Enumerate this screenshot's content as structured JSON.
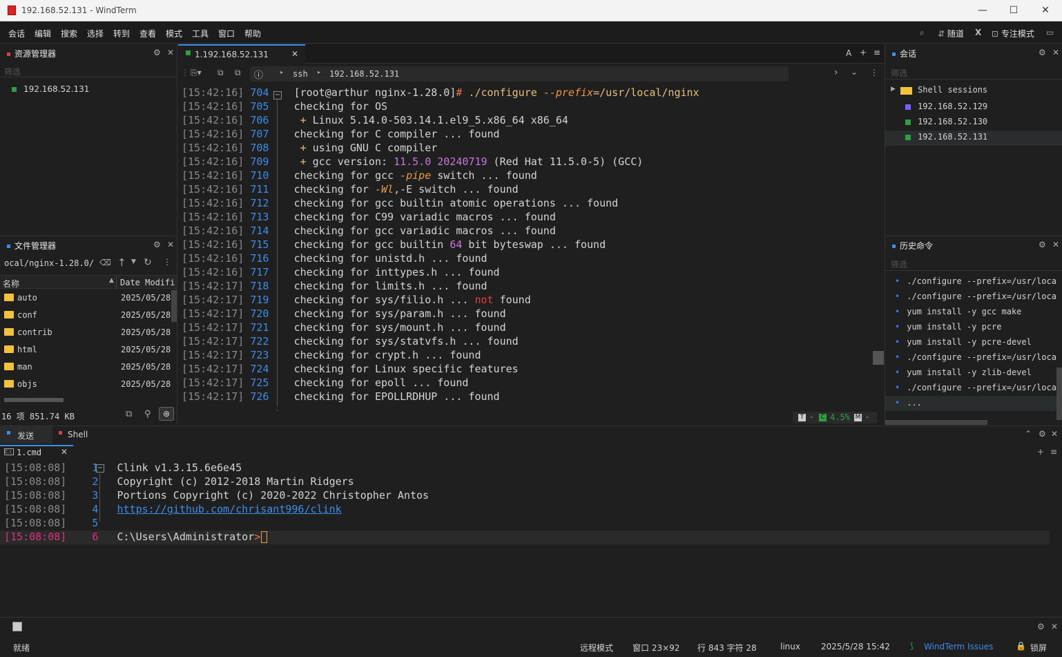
{
  "window": {
    "title": "192.168.52.131 - WindTerm"
  },
  "menu": [
    "会话",
    "编辑",
    "搜索",
    "选择",
    "转到",
    "查看",
    "模式",
    "工具",
    "窗口",
    "帮助"
  ],
  "right_tools": {
    "random": "随道",
    "focus": "专注模式"
  },
  "explorer": {
    "title": "资源管理器",
    "filter": "筛选",
    "item": "192.168.52.131"
  },
  "files": {
    "title": "文件管理器",
    "path": "ocal/nginx-1.28.0/",
    "col_name": "名称",
    "col_date": "Date Modifi",
    "rows": [
      {
        "name": "auto",
        "date": "2025/05/28"
      },
      {
        "name": "conf",
        "date": "2025/05/28"
      },
      {
        "name": "contrib",
        "date": "2025/05/28"
      },
      {
        "name": "html",
        "date": "2025/05/28"
      },
      {
        "name": "man",
        "date": "2025/05/28"
      },
      {
        "name": "objs",
        "date": "2025/05/28"
      }
    ],
    "summary": "16 项 851.74 KB"
  },
  "tab": {
    "label": "1.192.168.52.131",
    "font_btn": "A"
  },
  "crumb": {
    "proto": "ssh",
    "host": "192.168.52.131"
  },
  "terminal": {
    "lines": [
      {
        "ts": "[15:42:16]",
        "n": "704",
        "segs": [
          {
            "t": "[root@arthur nginx-1.28.0]",
            "c": "#d4d4d4"
          },
          {
            "t": "# ",
            "c": "#e8764b"
          },
          {
            "t": "./configure ",
            "c": "#e5c07b"
          },
          {
            "t": "--prefix",
            "c": "#e89a3c",
            "i": true
          },
          {
            "t": "=/usr/local/nginx",
            "c": "#e5c07b"
          }
        ]
      },
      {
        "ts": "[15:42:16]",
        "n": "705",
        "segs": [
          {
            "t": "checking for OS",
            "c": "#d4d4d4"
          }
        ]
      },
      {
        "ts": "[15:42:16]",
        "n": "706",
        "segs": [
          {
            "t": " + ",
            "c": "#e5c07b"
          },
          {
            "t": "Linux 5.14.0-503.14.1.el9_5.x86_64 x86_64",
            "c": "#d4d4d4"
          }
        ]
      },
      {
        "ts": "[15:42:16]",
        "n": "707",
        "segs": [
          {
            "t": "checking for C compiler ... found",
            "c": "#d4d4d4"
          }
        ]
      },
      {
        "ts": "[15:42:16]",
        "n": "708",
        "segs": [
          {
            "t": " + ",
            "c": "#e5c07b"
          },
          {
            "t": "using GNU C compiler",
            "c": "#d4d4d4"
          }
        ]
      },
      {
        "ts": "[15:42:16]",
        "n": "709",
        "segs": [
          {
            "t": " + ",
            "c": "#e5c07b"
          },
          {
            "t": "gcc version: ",
            "c": "#d4d4d4"
          },
          {
            "t": "11.5.0 20240719",
            "c": "#c678dd"
          },
          {
            "t": " (Red Hat 11.5.0-5) (GCC)",
            "c": "#d4d4d4"
          }
        ]
      },
      {
        "ts": "[15:42:16]",
        "n": "710",
        "segs": [
          {
            "t": "checking for gcc ",
            "c": "#d4d4d4"
          },
          {
            "t": "-pipe",
            "c": "#e89a3c",
            "i": true
          },
          {
            "t": " switch ... found",
            "c": "#d4d4d4"
          }
        ]
      },
      {
        "ts": "[15:42:16]",
        "n": "711",
        "segs": [
          {
            "t": "checking for ",
            "c": "#d4d4d4"
          },
          {
            "t": "-Wl",
            "c": "#e89a3c",
            "i": true
          },
          {
            "t": ",-E switch ... found",
            "c": "#d4d4d4"
          }
        ]
      },
      {
        "ts": "[15:42:16]",
        "n": "712",
        "segs": [
          {
            "t": "checking for gcc builtin atomic operations ... found",
            "c": "#d4d4d4"
          }
        ]
      },
      {
        "ts": "[15:42:16]",
        "n": "713",
        "segs": [
          {
            "t": "checking for C99 variadic macros ... found",
            "c": "#d4d4d4"
          }
        ]
      },
      {
        "ts": "[15:42:16]",
        "n": "714",
        "segs": [
          {
            "t": "checking for gcc variadic macros ... found",
            "c": "#d4d4d4"
          }
        ]
      },
      {
        "ts": "[15:42:16]",
        "n": "715",
        "segs": [
          {
            "t": "checking for gcc builtin ",
            "c": "#d4d4d4"
          },
          {
            "t": "64",
            "c": "#c678dd"
          },
          {
            "t": " bit byteswap ... found",
            "c": "#d4d4d4"
          }
        ]
      },
      {
        "ts": "[15:42:16]",
        "n": "716",
        "segs": [
          {
            "t": "checking for unistd.h ... found",
            "c": "#d4d4d4"
          }
        ]
      },
      {
        "ts": "[15:42:16]",
        "n": "717",
        "segs": [
          {
            "t": "checking for inttypes.h ... found",
            "c": "#d4d4d4"
          }
        ]
      },
      {
        "ts": "[15:42:17]",
        "n": "718",
        "segs": [
          {
            "t": "checking for limits.h ... found",
            "c": "#d4d4d4"
          }
        ]
      },
      {
        "ts": "[15:42:17]",
        "n": "719",
        "segs": [
          {
            "t": "checking for sys/filio.h ... ",
            "c": "#d4d4d4"
          },
          {
            "t": "not",
            "c": "#e04040"
          },
          {
            "t": " found",
            "c": "#d4d4d4"
          }
        ]
      },
      {
        "ts": "[15:42:17]",
        "n": "720",
        "segs": [
          {
            "t": "checking for sys/param.h ... found",
            "c": "#d4d4d4"
          }
        ]
      },
      {
        "ts": "[15:42:17]",
        "n": "721",
        "segs": [
          {
            "t": "checking for sys/mount.h ... found",
            "c": "#d4d4d4"
          }
        ]
      },
      {
        "ts": "[15:42:17]",
        "n": "722",
        "segs": [
          {
            "t": "checking for sys/statvfs.h ... found",
            "c": "#d4d4d4"
          }
        ]
      },
      {
        "ts": "[15:42:17]",
        "n": "723",
        "segs": [
          {
            "t": "checking for crypt.h ... found",
            "c": "#d4d4d4"
          }
        ]
      },
      {
        "ts": "[15:42:17]",
        "n": "724",
        "segs": [
          {
            "t": "checking for Linux specific features",
            "c": "#d4d4d4"
          }
        ]
      },
      {
        "ts": "[15:42:17]",
        "n": "725",
        "segs": [
          {
            "t": "checking for epoll ... found",
            "c": "#d4d4d4"
          }
        ]
      },
      {
        "ts": "[15:42:17]",
        "n": "726",
        "segs": [
          {
            "t": "checking for EPOLLRDHUP ... found",
            "c": "#d4d4d4"
          }
        ]
      }
    ],
    "status": {
      "t": "T",
      "c": "C",
      "pct": "4.5%",
      "m": "M"
    }
  },
  "sessions": {
    "title": "会话",
    "filter": "筛选",
    "group": "Shell sessions",
    "items": [
      {
        "label": "192.168.52.129",
        "color": "#7b5cff"
      },
      {
        "label": "192.168.52.130",
        "color": "#2ea043"
      },
      {
        "label": "192.168.52.131",
        "color": "#2ea043"
      }
    ]
  },
  "history": {
    "title": "历史命令",
    "filter": "筛选",
    "items": [
      "./configure --prefix=/usr/local",
      "./configure --prefix=/usr/local",
      "yum install -y gcc make",
      "yum install -y pcre",
      "yum install -y pcre-devel",
      "./configure --prefix=/usr/local",
      "yum install -y zlib-devel",
      "./configure --prefix=/usr/local",
      "..."
    ]
  },
  "bottom": {
    "tab_send": "发送",
    "tab_shell": "Shell",
    "subtab": "1.cmd",
    "lines": [
      {
        "ts": "[15:08:08]",
        "n": "1",
        "text": "Clink v1.3.15.6e6e45"
      },
      {
        "ts": "[15:08:08]",
        "n": "2",
        "text": "Copyright (c) 2012-2018 Martin Ridgers"
      },
      {
        "ts": "[15:08:08]",
        "n": "3",
        "text": "Portions Copyright (c) 2020-2022 Christopher Antos"
      },
      {
        "ts": "[15:08:08]",
        "n": "4",
        "text": "https://github.com/chrisant996/clink"
      },
      {
        "ts": "[15:08:08]",
        "n": "5",
        "text": ""
      },
      {
        "ts": "[15:08:08]",
        "n": "6",
        "text": "C:\\Users\\Administrator"
      }
    ],
    "prompt_char": ">"
  },
  "statusbar": {
    "ready": "就绪",
    "mode": "远程模式",
    "window": "窗口 23×92",
    "pos": "行 843 字符 28",
    "os": "linux",
    "datetime": "2025/5/28 15:42",
    "issues": "WindTerm Issues",
    "lock": "锁屏"
  },
  "colors": {
    "accent": "#3b8eea",
    "green": "#2ea043",
    "prompt": "#e8764b",
    "string": "#e5c07b",
    "number": "#c678dd",
    "error": "#e04040",
    "bg": "#1f1f1f"
  }
}
